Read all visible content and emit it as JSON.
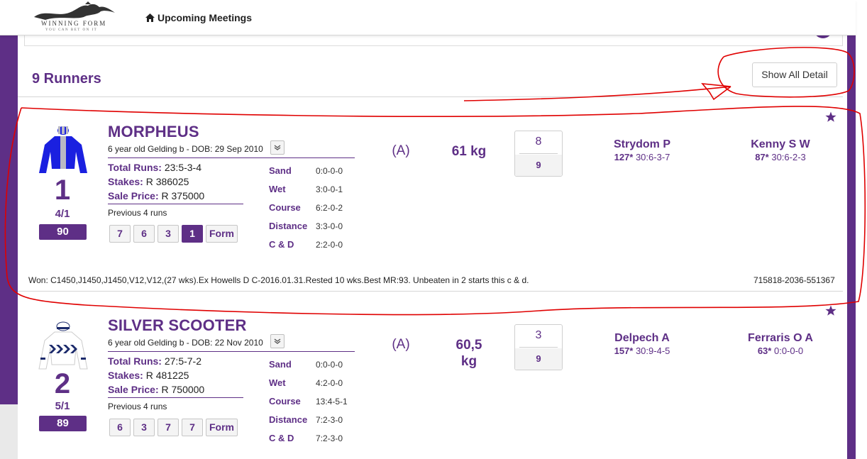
{
  "header": {
    "logo_text": "WINNING FORM",
    "logo_tagline": "YOU CAN BET ON IT",
    "nav_upcoming": "Upcoming Meetings"
  },
  "runners_section": {
    "title": "9 Runners",
    "show_detail_label": "Show All Detail"
  },
  "runners": [
    {
      "number": "1",
      "odds": "4/1",
      "rating": "90",
      "name": "MORPHEUS",
      "description": "6 year old Gelding b - DOB: 29 Sep 2010",
      "total_runs_label": "Total Runs:",
      "total_runs": "23:5-3-4",
      "stakes_label": "Stakes:",
      "stakes": "R 386025",
      "sale_price_label": "Sale Price:",
      "sale_price": "R 375000",
      "previous_label": "Previous 4 runs",
      "previous_runs": [
        "7",
        "6",
        "3",
        "1"
      ],
      "form_label": "Form",
      "conditions": [
        {
          "label": "Sand",
          "value": "0:0-0-0"
        },
        {
          "label": "Wet",
          "value": "3:0-0-1"
        },
        {
          "label": "Course",
          "value": "6:2-0-2"
        },
        {
          "label": "Distance",
          "value": "3:3-0-0"
        },
        {
          "label": "C & D",
          "value": "2:2-0-0"
        }
      ],
      "blinkers": "(A)",
      "weight": "61 kg",
      "draw": "8",
      "field": "9",
      "jockey": {
        "name": "Strydom P",
        "rating": "127*",
        "stats": " 30:6-3-7"
      },
      "trainer": {
        "name": "Kenny S W",
        "rating": "87*",
        "stats": " 30:6-2-3"
      },
      "comment": "Won: C1450,J1450,J1450,V12,V12,(27 wks).Ex Howells D C-2016.01.31.Rested 10 wks.Best MR:93. Unbeaten in 2 starts this c & d.",
      "reference": "715818-2036-551367",
      "silk_colors": {
        "body": "#1a20e0",
        "stripe": "#b9b9c4"
      }
    },
    {
      "number": "2",
      "odds": "5/1",
      "rating": "89",
      "name": "SILVER SCOOTER",
      "description": "6 year old Gelding b - DOB: 22 Nov 2010",
      "total_runs_label": "Total Runs:",
      "total_runs": "27:5-7-2",
      "stakes_label": "Stakes:",
      "stakes": "R 481225",
      "sale_price_label": "Sale Price:",
      "sale_price": "R 750000",
      "previous_label": "Previous 4 runs",
      "previous_runs": [
        "6",
        "3",
        "7",
        "7"
      ],
      "form_label": "Form",
      "conditions": [
        {
          "label": "Sand",
          "value": "0:0-0-0"
        },
        {
          "label": "Wet",
          "value": "4:2-0-0"
        },
        {
          "label": "Course",
          "value": "13:4-5-1"
        },
        {
          "label": "Distance",
          "value": "7:2-3-0"
        },
        {
          "label": "C & D",
          "value": "7:2-3-0"
        }
      ],
      "blinkers": "(A)",
      "weight_line1": "60,5",
      "weight_line2": "kg",
      "draw": "3",
      "field": "9",
      "jockey": {
        "name": "Delpech A",
        "rating": "157*",
        "stats": " 30:9-4-5"
      },
      "trainer": {
        "name": "Ferraris O A",
        "rating": "63*",
        "stats": " 0:0-0-0"
      },
      "silk_colors": {
        "body": "#ffffff",
        "chevron": "#1b2a6b"
      }
    }
  ],
  "colors": {
    "brand_purple": "#5e2f86",
    "annotation_red": "#e00000"
  },
  "icons": [
    "home-icon",
    "chevron-down-icon",
    "star-icon"
  ]
}
